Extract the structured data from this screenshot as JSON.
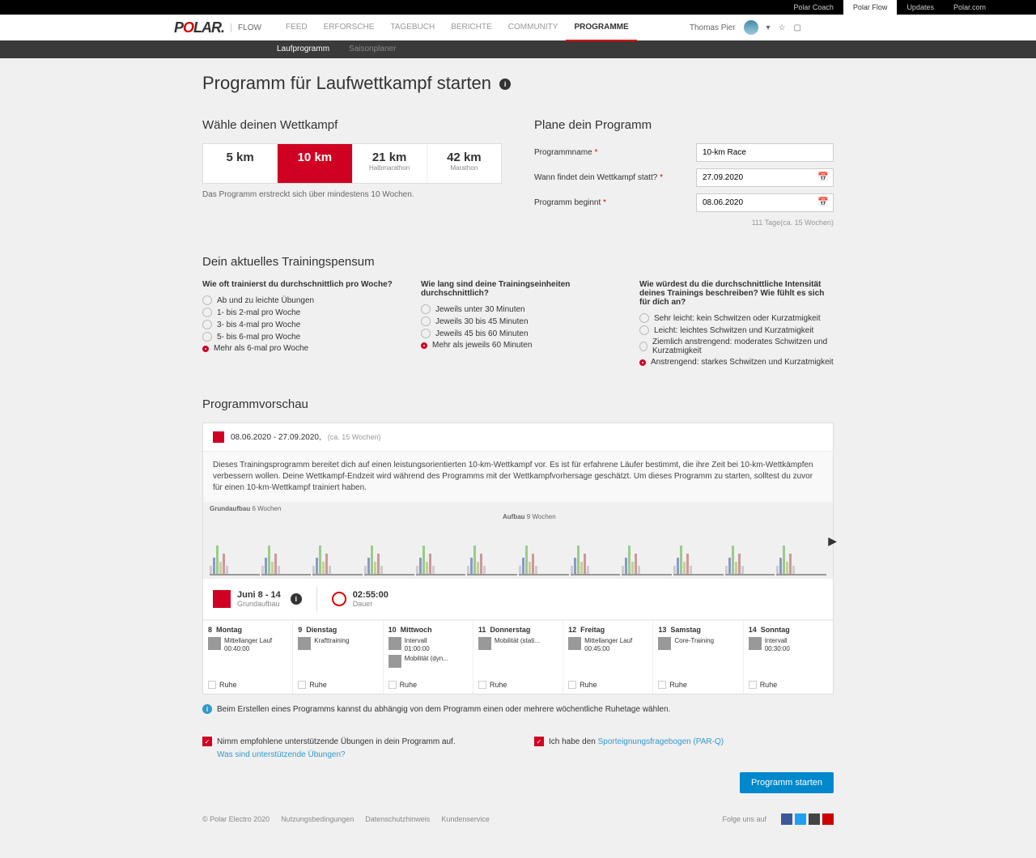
{
  "topbar": {
    "links": [
      "Polar Coach",
      "Polar Flow",
      "Updates",
      "Polar.com"
    ],
    "active": 1
  },
  "header": {
    "logo": "POLAR.",
    "flow": "FLOW",
    "nav": [
      "FEED",
      "ERFORSCHE",
      "TAGEBUCH",
      "BERICHTE",
      "COMMUNITY",
      "PROGRAMME"
    ],
    "active": 5,
    "user": "Thomas Pier"
  },
  "subnav": {
    "items": [
      "Laufprogramm",
      "Saisonplaner"
    ],
    "active": 0
  },
  "page": {
    "title": "Programm für Laufwettkampf starten"
  },
  "choose": {
    "heading": "Wähle deinen Wettkampf",
    "events": [
      {
        "dist": "5 km"
      },
      {
        "dist": "10 km"
      },
      {
        "dist": "21 km",
        "sub": "Halbmarathon"
      },
      {
        "dist": "42 km",
        "sub": "Marathon"
      }
    ],
    "selected": 1,
    "note": "Das Programm erstreckt sich über mindestens 10 Wochen."
  },
  "plan": {
    "heading": "Plane dein Programm",
    "name_label": "Programmname",
    "name_value": "10-km Race",
    "when_label": "Wann findet dein Wettkampf statt?",
    "when_value": "27.09.2020",
    "start_label": "Programm beginnt",
    "start_value": "08.06.2020",
    "hint": "111 Tage(ca. 15 Wochen)"
  },
  "training": {
    "heading": "Dein aktuelles Trainingspensum",
    "q1": {
      "q": "Wie oft trainierst du durchschnittlich pro Woche?",
      "opts": [
        "Ab und zu leichte Übungen",
        "1- bis 2-mal pro Woche",
        "3- bis 4-mal pro Woche",
        "5- bis 6-mal pro Woche",
        "Mehr als 6-mal pro Woche"
      ],
      "sel": 4
    },
    "q2": {
      "q": "Wie lang sind deine Trainingseinheiten durchschnittlich?",
      "opts": [
        "Jeweils unter 30 Minuten",
        "Jeweils 30 bis 45 Minuten",
        "Jeweils 45 bis 60 Minuten",
        "Mehr als jeweils 60 Minuten"
      ],
      "sel": 3
    },
    "q3": {
      "q": "Wie würdest du die durchschnittliche Intensität deines Trainings beschreiben? Wie fühlt es sich für dich an?",
      "opts": [
        "Sehr leicht: kein Schwitzen oder Kurzatmigkeit",
        "Leicht: leichtes Schwitzen und Kurzatmigkeit",
        "Ziemlich anstrengend: moderates Schwitzen und Kurzatmigkeit",
        "Anstrengend: starkes Schwitzen und Kurzatmigkeit"
      ],
      "sel": 3
    }
  },
  "preview": {
    "heading": "Programmvorschau",
    "range": "08.06.2020 - 27.09.2020,",
    "weeks": "(ca. 15 Wochen)",
    "desc": "Dieses Trainingsprogramm bereitet dich auf einen leistungsorientierten 10-km-Wettkampf vor. Es ist für erfahrene Läufer bestimmt, die ihre Zeit bei 10-km-Wettkämpfen verbessern wollen. Deine Wettkampf-Endzeit wird während des Programms mit der Wettkampfvorhersage geschätzt. Um dieses Programm zu starten, solltest du zuvor für einen 10-km-Wettkampf trainiert haben.",
    "phase1": "Grundaufbau",
    "phase1_w": "6 Wochen",
    "phase2": "Aufbau",
    "phase2_w": "9 Wochen",
    "week_title": "Juni 8 - 14",
    "week_phase": "Grundaufbau",
    "duration": "02:55:00",
    "duration_label": "Dauer",
    "days": [
      {
        "n": "8",
        "d": "Montag",
        "acts": [
          {
            "t": "Mittellanger Lauf",
            "s": "00:40:00"
          }
        ]
      },
      {
        "n": "9",
        "d": "Dienstag",
        "acts": [
          {
            "t": "Krafttraining",
            "s": ""
          }
        ]
      },
      {
        "n": "10",
        "d": "Mittwoch",
        "acts": [
          {
            "t": "Intervall",
            "s": "01:00:00"
          },
          {
            "t": "Mobilität (dyn...",
            "s": ""
          }
        ]
      },
      {
        "n": "11",
        "d": "Donnerstag",
        "acts": [
          {
            "t": "Mobilität (stati...",
            "s": ""
          }
        ]
      },
      {
        "n": "12",
        "d": "Freitag",
        "acts": [
          {
            "t": "Mittellanger Lauf",
            "s": "00:45:00"
          }
        ]
      },
      {
        "n": "13",
        "d": "Samstag",
        "acts": [
          {
            "t": "Core-Training",
            "s": ""
          }
        ]
      },
      {
        "n": "14",
        "d": "Sonntag",
        "acts": [
          {
            "t": "Intervall",
            "s": "00:30:00"
          }
        ]
      }
    ],
    "rest": "Ruhe"
  },
  "info": {
    "rest_note": "Beim Erstellen eines Programms kannst du abhängig von dem Programm einen oder mehrere wöchentliche Ruhetage wählen.",
    "check1": "Nimm empfohlene unterstützende Übungen in dein Programm auf.",
    "check1_link": "Was sind unterstützende Übungen?",
    "check2_pre": "Ich habe den ",
    "check2_link": "Sporteignungsfragebogen (PAR-Q)"
  },
  "button": "Programm starten",
  "footer": {
    "copy": "© Polar Electro 2020",
    "links": [
      "Nutzungsbedingungen",
      "Datenschutzhinweis",
      "Kundenservice"
    ],
    "follow": "Folge uns auf"
  }
}
